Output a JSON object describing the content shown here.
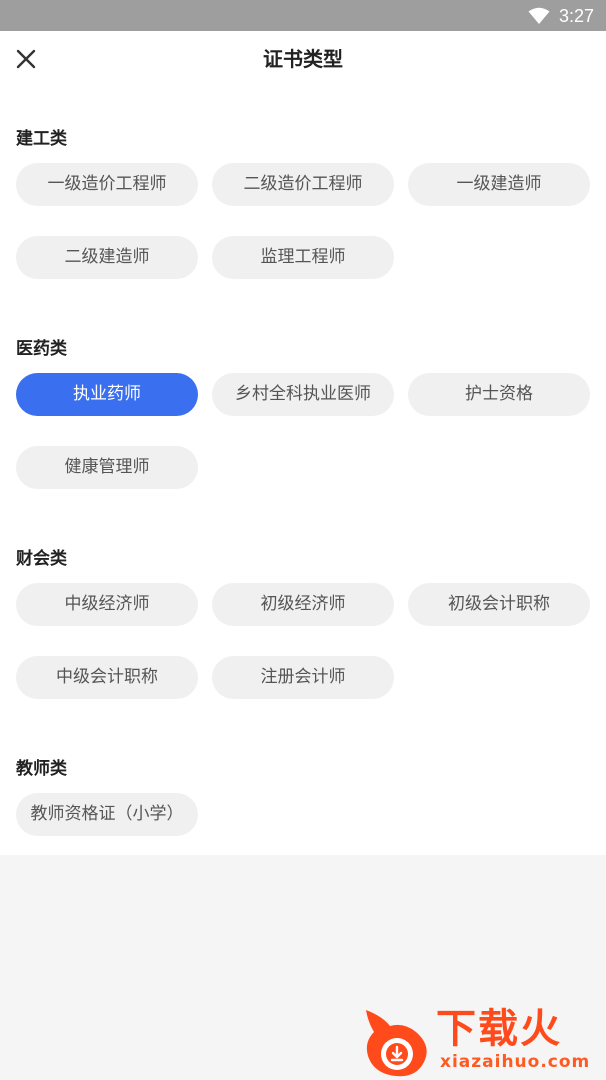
{
  "status_bar": {
    "time": "3:27",
    "icons": [
      "wifi-icon"
    ]
  },
  "header": {
    "title": "证书类型",
    "close_icon": "close-icon"
  },
  "sections": [
    {
      "title": "建工类",
      "chips": [
        "一级造价工程师",
        "二级造价工程师",
        "一级建造师",
        "二级建造师",
        "监理工程师"
      ]
    },
    {
      "title": "医药类",
      "chips": [
        "执业药师",
        "乡村全科执业医师",
        "护士资格",
        "健康管理师"
      ]
    },
    {
      "title": "财会类",
      "chips": [
        "中级经济师",
        "初级经济师",
        "初级会计职称",
        "中级会计职称",
        "注册会计师"
      ]
    },
    {
      "title": "教师类",
      "chips": [
        "教师资格证（小学）"
      ]
    }
  ],
  "selected_chip": "执业药师",
  "colors": {
    "accent": "#3a6ff0",
    "chip_bg": "#f0f0f0",
    "status_bar": "#9e9e9e",
    "watermark": "#ff4a1c"
  },
  "watermark": {
    "brand": "下载火",
    "url": "xiazaihuo.com"
  }
}
